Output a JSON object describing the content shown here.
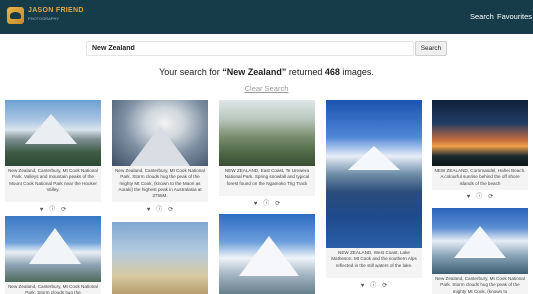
{
  "brand": {
    "title": "JASON FRIEND",
    "subtitle": "PHOTOGRAPHY"
  },
  "nav": {
    "search": "Search",
    "favourites": "Favourites"
  },
  "search": {
    "value": "New Zealand",
    "button": "Search"
  },
  "results": {
    "prefix": "Your search for ",
    "query": "“New Zealand”",
    "middle": " returned ",
    "count": "468",
    "suffix": " images."
  },
  "clear": "Clear Search",
  "colors": {
    "navbar": "#163c4a",
    "accent": "#e0a83c"
  },
  "icons": {
    "favourite": "heart-icon",
    "info": "info-icon",
    "share": "share-icon"
  },
  "cards": [
    {
      "caption": "New Zealand, Canterbury, Mt Cook National Park. Valleys and mountain peaks of the Mount Cook National Park near the Hooker Valley."
    },
    {
      "caption": "New Zealand, Canterbury, Mt Cook National Park. Storm clouds hug the peak of the mighty Mt Cook, (known to the Maori as Aoraki) the highest peak in Australasia at 3755M."
    },
    {
      "caption": "NEW ZEALAND, East Coast, Te Urewera National Park. Spring snowfall and typical forest found on the Ngamoko Trig Track"
    },
    {
      "caption": "NEW ZEALAND, West Coast, Lake Matheson. Mt Cook and the southern Alps reflected in the still waters of the lake."
    },
    {
      "caption": "NEW ZEALAND, Coromandel, Hahei Beach. A colourful sunrise behind the off shore islands of the beach"
    },
    {
      "caption": "New Zealand, Canterbury, Mt Cook National Park. Storm clouds hug the"
    },
    {
      "caption": ""
    },
    {
      "caption": ""
    },
    {
      "caption": "New Zealand, Canterbury, Mt Cook National Park. Storm clouds hug the peak of the mighty Mt Cook, (known to"
    }
  ]
}
